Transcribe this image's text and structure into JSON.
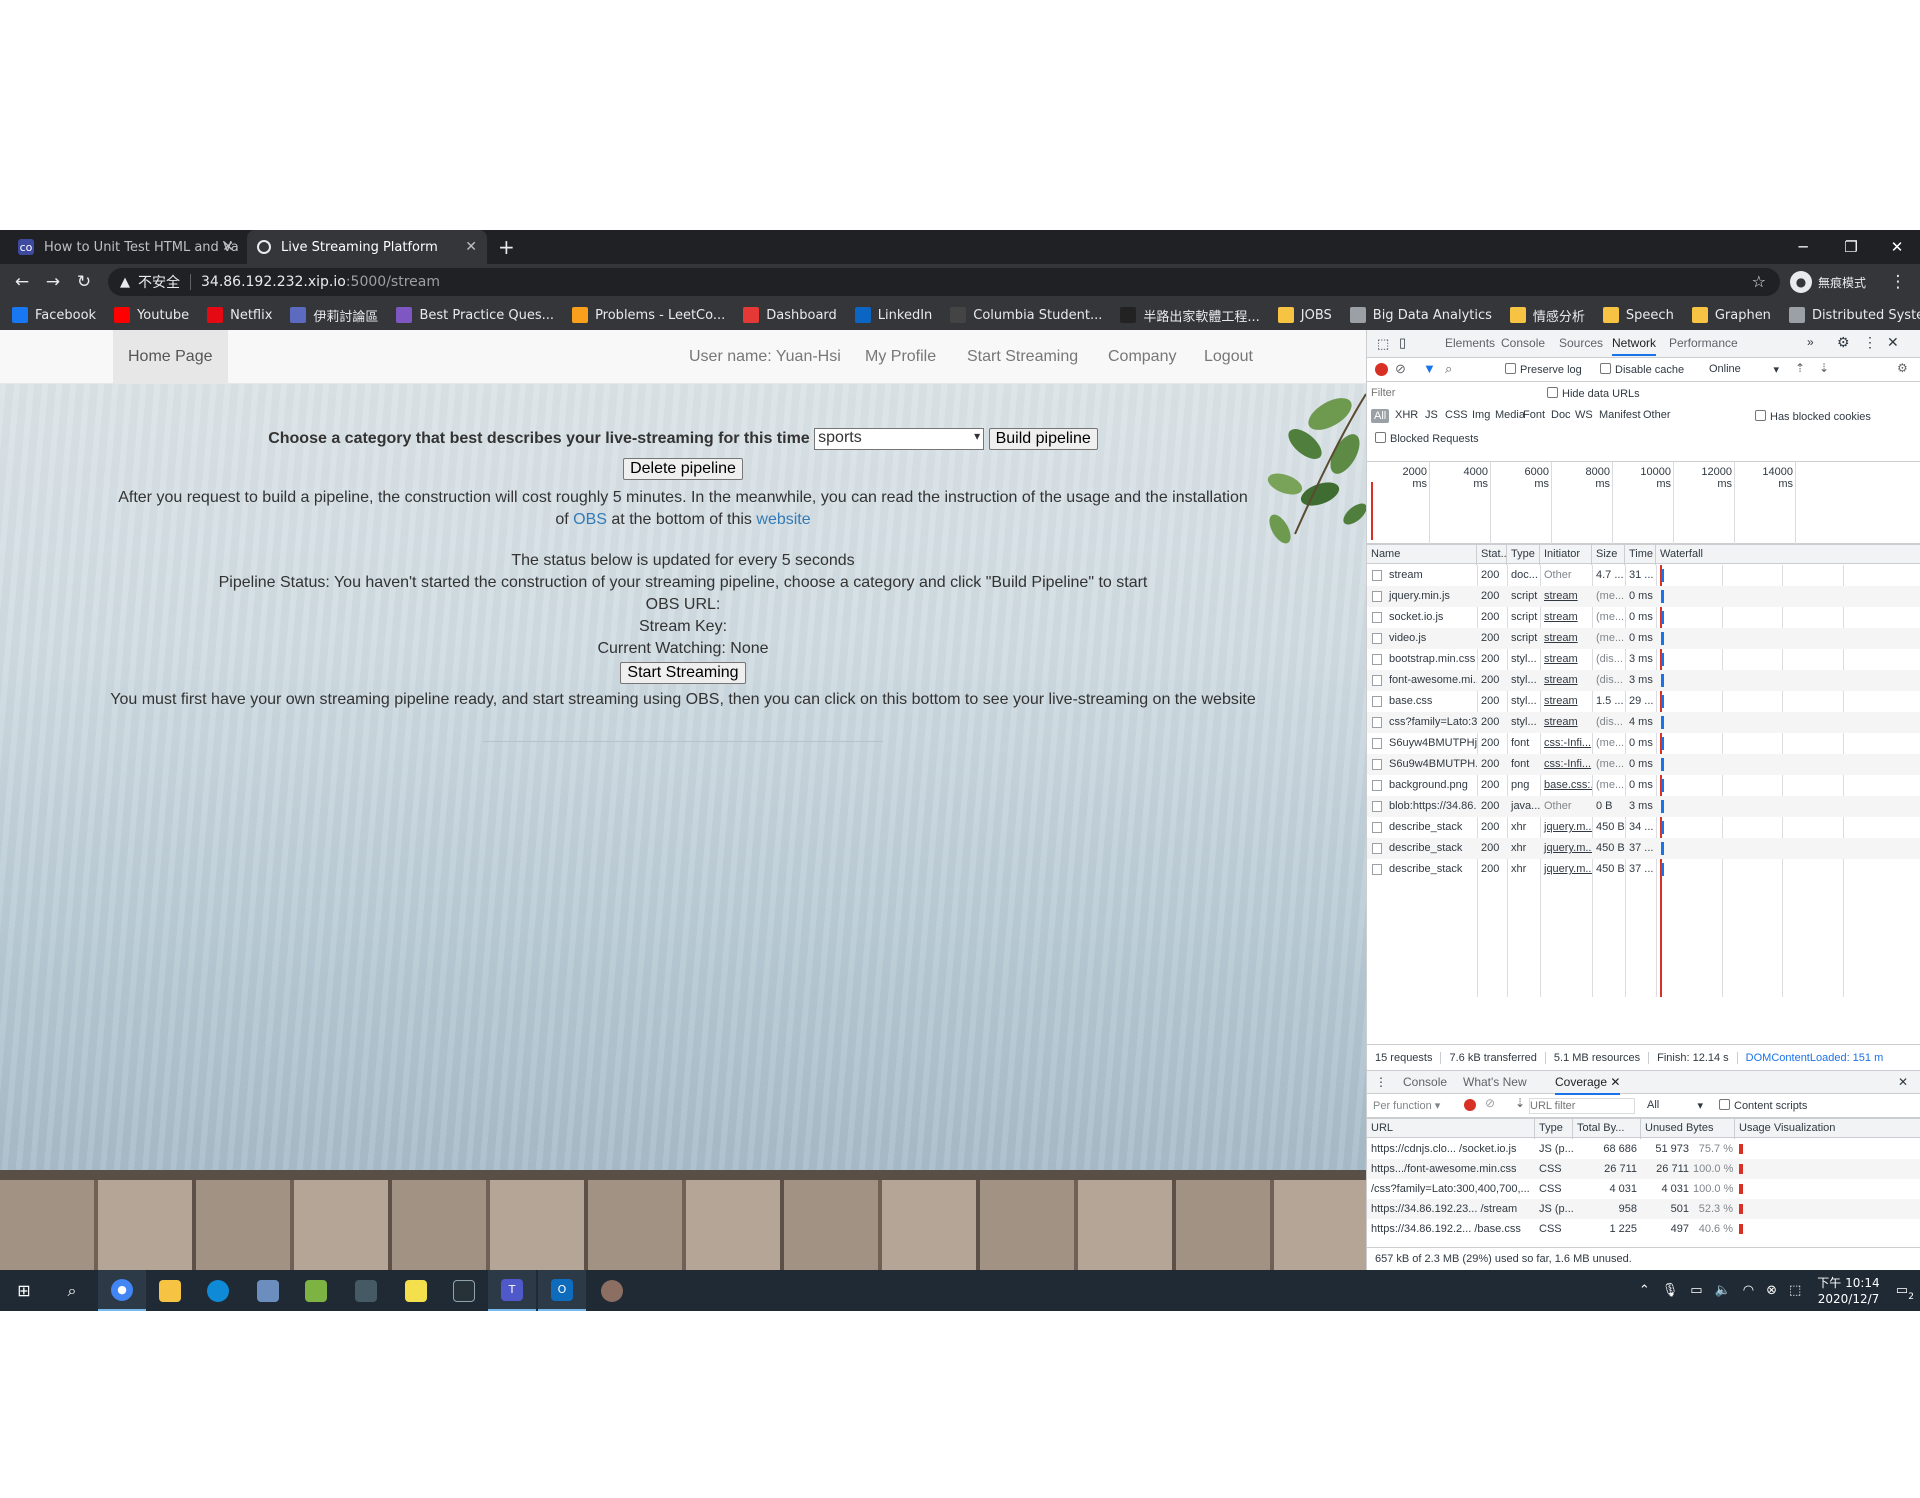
{
  "browser": {
    "tabs": [
      {
        "title": "How to Unit Test HTML and Va",
        "icon": "codementor-icon",
        "active": false
      },
      {
        "title": "Live Streaming Platform",
        "icon": "globe-icon",
        "active": true
      }
    ],
    "new_tab": "+",
    "window_controls": {
      "minimize": "─",
      "maximize": "❐",
      "close": "✕"
    },
    "address": {
      "security_label": "不安全",
      "host": "34.86.192.232.xip.io",
      "path": ":5000/stream"
    },
    "incognito_label": "無痕模式",
    "bookmarks": [
      {
        "label": "Facebook",
        "icon": "facebook-icon",
        "color": "#1877f2"
      },
      {
        "label": "Youtube",
        "icon": "youtube-icon",
        "color": "#ff0000"
      },
      {
        "label": "Netflix",
        "icon": "netflix-icon",
        "color": "#e50914"
      },
      {
        "label": "伊莉討論區",
        "icon": "forum-icon",
        "color": "#5c6bc0"
      },
      {
        "label": "Best Practice Ques...",
        "icon": "code-icon",
        "color": "#7e57c2"
      },
      {
        "label": "Problems - LeetCo...",
        "icon": "leetcode-icon",
        "color": "#f89f1b"
      },
      {
        "label": "Dashboard",
        "icon": "dashboard-icon",
        "color": "#e53935"
      },
      {
        "label": "LinkedIn",
        "icon": "linkedin-icon",
        "color": "#0a66c2"
      },
      {
        "label": "Columbia Student...",
        "icon": "columbia-icon",
        "color": "#444444"
      },
      {
        "label": "半路出家軟體工程...",
        "icon": "blog-icon",
        "color": "#222222"
      },
      {
        "label": "JOBS",
        "icon": "folder-icon",
        "color": "#f6c342"
      },
      {
        "label": "Big Data Analytics",
        "icon": "globe-icon",
        "color": "#9aa0a6"
      },
      {
        "label": "情感分析",
        "icon": "folder-icon",
        "color": "#f6c342"
      },
      {
        "label": "Speech",
        "icon": "folder-icon",
        "color": "#f6c342"
      },
      {
        "label": "Graphen",
        "icon": "folder-icon",
        "color": "#f6c342"
      },
      {
        "label": "Distributed Syste...",
        "icon": "globe-icon",
        "color": "#9aa0a6"
      }
    ]
  },
  "site": {
    "nav": {
      "home": "Home Page",
      "username": "User name: Yuan-Hsi",
      "profile": "My Profile",
      "start_streaming": "Start Streaming",
      "company": "Company",
      "logout": "Logout"
    },
    "category_prompt": "Choose a category that best describes your live-streaming for this time",
    "category_selected": "sports",
    "build_button": "Build pipeline",
    "delete_button": "Delete pipeline",
    "info_text_1": "After you request to build a pipeline, the construction will cost roughly 5 minutes. In the meanwhile, you can read the instruction of the usage and the installation of",
    "obs_link": "OBS",
    "info_text_2": "at the bottom of this",
    "website_link": "website",
    "status_note": "The status below is updated for every 5 seconds",
    "pipeline_status": "Pipeline Status: You haven't started the construction of your streaming pipeline, choose a category and click \"Build Pipeline\" to start",
    "obs_url": "OBS URL:",
    "stream_key": "Stream Key:",
    "current_watching": "Current Watching: None",
    "start_button": "Start Streaming",
    "footer_note": "You must first have your own streaming pipeline ready, and start streaming using OBS, then you can click on this bottom to see your live-streaming on the website"
  },
  "devtools": {
    "tabs": [
      "Elements",
      "Console",
      "Sources",
      "Network",
      "Performance"
    ],
    "active_tab": "Network",
    "more": "»",
    "preserve_log": "Preserve log",
    "disable_cache": "Disable cache",
    "throttle": "Online",
    "filter_placeholder": "Filter",
    "hide_data_urls": "Hide data URLs",
    "type_filters": [
      "All",
      "XHR",
      "JS",
      "CSS",
      "Img",
      "Media",
      "Font",
      "Doc",
      "WS",
      "Manifest",
      "Other"
    ],
    "has_blocked_cookies": "Has blocked cookies",
    "blocked_requests": "Blocked Requests",
    "timeline_ticks": [
      "2000 ms",
      "4000 ms",
      "6000 ms",
      "8000 ms",
      "10000 ms",
      "12000 ms",
      "14000 ms"
    ],
    "columns": [
      "Name",
      "Stat...",
      "Type",
      "Initiator",
      "Size",
      "Time",
      "Waterfall"
    ],
    "requests": [
      {
        "name": "stream",
        "status": "200",
        "type": "doc...",
        "initiator": "Other",
        "size": "4.7 ...",
        "time": "31 ..."
      },
      {
        "name": "jquery.min.js",
        "status": "200",
        "type": "script",
        "initiator": "stream",
        "size": "(me...",
        "time": "0 ms"
      },
      {
        "name": "socket.io.js",
        "status": "200",
        "type": "script",
        "initiator": "stream",
        "size": "(me...",
        "time": "0 ms"
      },
      {
        "name": "video.js",
        "status": "200",
        "type": "script",
        "initiator": "stream",
        "size": "(me...",
        "time": "0 ms"
      },
      {
        "name": "bootstrap.min.css",
        "status": "200",
        "type": "styl...",
        "initiator": "stream",
        "size": "(dis...",
        "time": "3 ms"
      },
      {
        "name": "font-awesome.mi...",
        "status": "200",
        "type": "styl...",
        "initiator": "stream",
        "size": "(dis...",
        "time": "3 ms"
      },
      {
        "name": "base.css",
        "status": "200",
        "type": "styl...",
        "initiator": "stream",
        "size": "1.5 ...",
        "time": "29 ..."
      },
      {
        "name": "css?family=Lato:3...",
        "status": "200",
        "type": "styl...",
        "initiator": "stream",
        "size": "(dis...",
        "time": "4 ms"
      },
      {
        "name": "S6uyw4BMUTPHj...",
        "status": "200",
        "type": "font",
        "initiator": "css:-Infi...",
        "size": "(me...",
        "time": "0 ms"
      },
      {
        "name": "S6u9w4BMUTPH...",
        "status": "200",
        "type": "font",
        "initiator": "css:-Infi...",
        "size": "(me...",
        "time": "0 ms"
      },
      {
        "name": "background.png",
        "status": "200",
        "type": "png",
        "initiator": "base.css:...",
        "size": "(me...",
        "time": "0 ms"
      },
      {
        "name": "blob:https://34.86...",
        "status": "200",
        "type": "java...",
        "initiator": "Other",
        "size": "0 B",
        "time": "3 ms"
      },
      {
        "name": "describe_stack",
        "status": "200",
        "type": "xhr",
        "initiator": "jquery.m...",
        "size": "450 B",
        "time": "34 ..."
      },
      {
        "name": "describe_stack",
        "status": "200",
        "type": "xhr",
        "initiator": "jquery.m...",
        "size": "450 B",
        "time": "37 ..."
      },
      {
        "name": "describe_stack",
        "status": "200",
        "type": "xhr",
        "initiator": "jquery.m...",
        "size": "450 B",
        "time": "37 ..."
      }
    ],
    "summary": {
      "requests": "15 requests",
      "transferred": "7.6 kB transferred",
      "resources": "5.1 MB resources",
      "finish": "Finish: 12.14 s",
      "dcl": "DOMContentLoaded: 151 m"
    },
    "drawer_tabs": [
      "Console",
      "What's New",
      "Coverage"
    ],
    "coverage": {
      "per_function": "Per function",
      "url_filter_placeholder": "URL filter",
      "all": "All",
      "content_scripts": "Content scripts",
      "columns": [
        "URL",
        "Type",
        "Total By...",
        "Unused Bytes",
        "Usage Visualization"
      ],
      "rows": [
        {
          "url": "https://cdnjs.clo... /socket.io.js",
          "type": "JS (p...",
          "total": "68 686",
          "unused": "51 973",
          "pct": "75.7 %"
        },
        {
          "url": "https.../font-awesome.min.css",
          "type": "CSS",
          "total": "26 711",
          "unused": "26 711",
          "pct": "100.0 %"
        },
        {
          "url": "/css?family=Lato:300,400,700,...",
          "type": "CSS",
          "total": "4 031",
          "unused": "4 031",
          "pct": "100.0 %"
        },
        {
          "url": "https://34.86.192.23... /stream",
          "type": "JS (p...",
          "total": "958",
          "unused": "501",
          "pct": "52.3 %"
        },
        {
          "url": "https://34.86.192.2... /base.css",
          "type": "CSS",
          "total": "1 225",
          "unused": "497",
          "pct": "40.6 %"
        }
      ],
      "footer": "657 kB of 2.3 MB (29%) used so far, 1.6 MB unused."
    }
  },
  "taskbar": {
    "time": "下午 10:14",
    "date": "2020/12/7",
    "notification_count": "2"
  }
}
